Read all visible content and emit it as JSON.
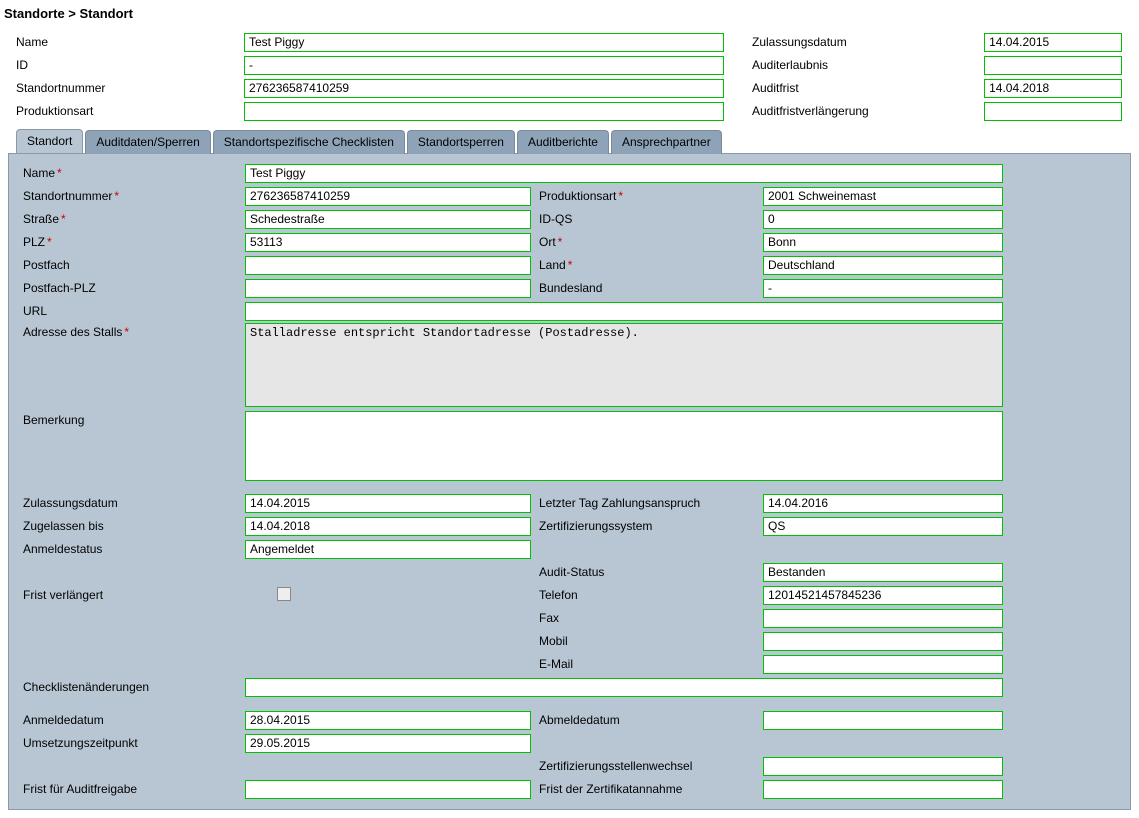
{
  "breadcrumb": "Standorte > Standort",
  "header": {
    "left": {
      "name_label": "Name",
      "name_value": "Test Piggy",
      "id_label": "ID",
      "id_value": "-",
      "standortnummer_label": "Standortnummer",
      "standortnummer_value": "276236587410259",
      "produktionsart_label": "Produktionsart",
      "produktionsart_value": ""
    },
    "right": {
      "zulassungsdatum_label": "Zulassungsdatum",
      "zulassungsdatum_value": "14.04.2015",
      "auditerlaubnis_label": "Auditerlaubnis",
      "auditerlaubnis_value": "",
      "auditfrist_label": "Auditfrist",
      "auditfrist_value": "14.04.2018",
      "auditfristverl_label": "Auditfristverlängerung",
      "auditfristverl_value": ""
    }
  },
  "tabs": {
    "t0": "Standort",
    "t1": "Auditdaten/Sperren",
    "t2": "Standortspezifische Checklisten",
    "t3": "Standortsperren",
    "t4": "Auditberichte",
    "t5": "Ansprechpartner"
  },
  "form": {
    "name_label": "Name",
    "name_value": "Test Piggy",
    "standortnummer_label": "Standortnummer",
    "standortnummer_value": "276236587410259",
    "produktionsart_label": "Produktionsart",
    "produktionsart_value": "2001 Schweinemast",
    "strasse_label": "Straße",
    "strasse_value": "Schedestraße",
    "idqs_label": "ID-QS",
    "idqs_value": "0",
    "plz_label": "PLZ",
    "plz_value": "53113",
    "ort_label": "Ort",
    "ort_value": "Bonn",
    "postfach_label": "Postfach",
    "postfach_value": "",
    "land_label": "Land",
    "land_value": "Deutschland",
    "postfachplz_label": "Postfach-PLZ",
    "postfachplz_value": "",
    "bundesland_label": "Bundesland",
    "bundesland_value": "-",
    "url_label": "URL",
    "url_value": "",
    "adresse_label": "Adresse des Stalls",
    "adresse_value": "Stalladresse entspricht Standortadresse (Postadresse).",
    "bemerkung_label": "Bemerkung",
    "bemerkung_value": "",
    "zulassungsdatum_label": "Zulassungsdatum",
    "zulassungsdatum_value": "14.04.2015",
    "letzter_label": "Letzter Tag Zahlungsanspruch",
    "letzter_value": "14.04.2016",
    "zugelassen_label": "Zugelassen bis",
    "zugelassen_value": "14.04.2018",
    "zertsys_label": "Zertifizierungssystem",
    "zertsys_value": "QS",
    "anmeldestatus_label": "Anmeldestatus",
    "anmeldestatus_value": "Angemeldet",
    "auditstatus_label": "Audit-Status",
    "auditstatus_value": "Bestanden",
    "fristverl_label": "Frist verlängert",
    "telefon_label": "Telefon",
    "telefon_value": "12014521457845236",
    "fax_label": "Fax",
    "fax_value": "",
    "mobil_label": "Mobil",
    "mobil_value": "",
    "email_label": "E-Mail",
    "email_value": "",
    "checklisten_label": "Checklistenänderungen",
    "checklisten_value": "",
    "anmeldedatum_label": "Anmeldedatum",
    "anmeldedatum_value": "28.04.2015",
    "abmeldedatum_label": "Abmeldedatum",
    "abmeldedatum_value": "",
    "umsetzung_label": "Umsetzungszeitpunkt",
    "umsetzung_value": "29.05.2015",
    "zertwechsel_label": "Zertifizierungsstellenwechsel",
    "zertwechsel_value": "",
    "fristaudit_label": "Frist für Auditfreigabe",
    "fristaudit_value": "",
    "fristzert_label": "Frist der Zertifikatannahme",
    "fristzert_value": ""
  }
}
